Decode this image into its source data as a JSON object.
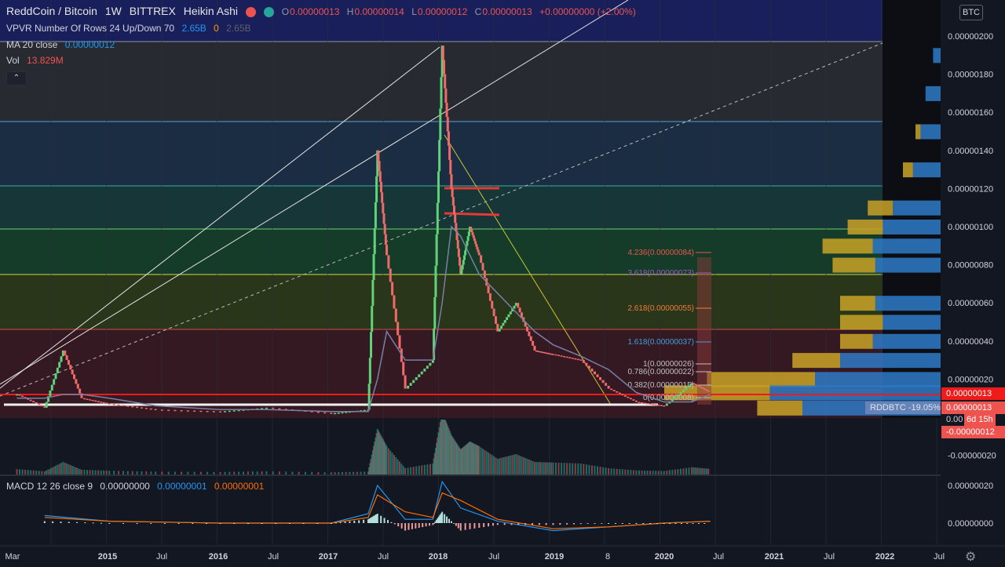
{
  "header": {
    "symbol": "ReddCoin / Bitcoin",
    "interval": "1W",
    "exchange": "BITTREX",
    "chart_style": "Heikin Ashi",
    "ohlc": [
      {
        "label": "O",
        "value": "0.00000013"
      },
      {
        "label": "H",
        "value": "0.00000014"
      },
      {
        "label": "L",
        "value": "0.00000012"
      },
      {
        "label": "C",
        "value": "0.00000013"
      }
    ],
    "change": "+0.00000000 (+2.00%)"
  },
  "indicators": {
    "vpvr": {
      "name": "VPVR Number Of Rows 24 Up/Down 70",
      "up": "2.65B",
      "down": "0",
      "total": "2.65B"
    },
    "ma": {
      "name": "MA 20 close",
      "value": "0.00000012"
    },
    "vol": {
      "name": "Vol",
      "value": "13.829M"
    },
    "macd": {
      "name": "MACD 12 26 close 9",
      "hist": "0.00000000",
      "macd": "0.00000001",
      "signal": "0.00000001"
    }
  },
  "currency_button": "BTC",
  "price_tags": {
    "last": "0.00000013",
    "ma": "0.00000013",
    "countdown_prefix": "0.00",
    "countdown": "6d 15h",
    "low": "-0.00000012",
    "symbol_change": "RDDBTC -19.05%"
  },
  "colors": {
    "background": "#131722",
    "up": "#26a69a",
    "down": "#ef5350",
    "ma": "#7a7fa8",
    "macd_line": "#2196f3",
    "signal_line": "#ff6d00",
    "vpvr_up": "#2f7ac7",
    "vpvr_down": "#c9a227"
  },
  "chart_data": [
    {
      "type": "line",
      "title": "ReddCoin / Bitcoin",
      "xlabel": "",
      "ylabel": "",
      "x_ticks": [
        "Mar",
        "2015",
        "Jul",
        "2016",
        "Jul",
        "2017",
        "Jul",
        "2018",
        "Jul",
        "2019",
        "8",
        "2020",
        "Jul",
        "2021",
        "Jul",
        "2022",
        "Jul"
      ],
      "y_ticks": [
        "0.00000200",
        "0.00000180",
        "0.00000160",
        "0.00000140",
        "0.00000120",
        "0.00000100",
        "0.00000080",
        "0.00000060",
        "0.00000040",
        "0.00000020",
        "-0.00000020"
      ],
      "ylim": [
        -3e-07,
        2.1e-06
      ],
      "x": [
        "2014-03",
        "2014-06",
        "2014-08",
        "2014-10",
        "2015-01",
        "2015-06",
        "2016-01",
        "2016-06",
        "2017-01",
        "2017-05",
        "2017-06",
        "2017-07",
        "2017-09",
        "2017-12",
        "2018-01",
        "2018-02",
        "2018-03",
        "2018-04",
        "2018-05",
        "2018-07",
        "2018-09",
        "2018-11",
        "2019-01",
        "2019-04",
        "2019-07",
        "2019-10",
        "2020-01",
        "2020-04",
        "2020-06"
      ],
      "series": [
        {
          "name": "close",
          "values": [
            1.2e-07,
            5e-08,
            3.5e-07,
            1e-07,
            7e-08,
            4e-08,
            3e-08,
            5e-08,
            2e-08,
            4e-08,
            1.4e-06,
            8.5e-07,
            1.5e-07,
            3e-07,
            1.95e-06,
            1.2e-06,
            7.5e-07,
            1e-06,
            8.5e-07,
            4.5e-07,
            6e-07,
            3.5e-07,
            3.3e-07,
            3e-07,
            1.5e-07,
            8e-08,
            6e-08,
            1.8e-07,
            1.3e-07
          ]
        },
        {
          "name": "MA 20 close",
          "values": [
            1e-07,
            1e-07,
            1.2e-07,
            1.2e-07,
            1e-07,
            6e-08,
            4e-08,
            4e-08,
            3e-08,
            3e-08,
            2e-07,
            4.5e-07,
            3e-07,
            3e-07,
            6e-07,
            1e-06,
            9.5e-07,
            8.5e-07,
            7.5e-07,
            6.5e-07,
            5.5e-07,
            4.5e-07,
            3.8e-07,
            3.2e-07,
            2.5e-07,
            1.3e-07,
            8e-08,
            8e-08,
            1.2e-07
          ]
        }
      ],
      "fib_levels": [
        {
          "label": "4.236(0.00000084)",
          "value": 8.4e-07
        },
        {
          "label": "3.618(0.00000073)",
          "value": 7.3e-07
        },
        {
          "label": "2.618(0.00000055)",
          "value": 5.5e-07
        },
        {
          "label": "1.618(0.00000037)",
          "value": 3.7e-07
        },
        {
          "label": "1(0.00000026)",
          "value": 2.6e-07
        },
        {
          "label": "0.786(0.00000022)",
          "value": 2.2e-07
        },
        {
          "label": "0.382(0.00000015)",
          "value": 1.5e-07
        },
        {
          "label": "0(0.00000008)",
          "value": 8e-08
        }
      ],
      "vpvr_rows": [
        {
          "price": 1.9e-06,
          "up": 0.03,
          "down": 0.0
        },
        {
          "price": 1.7e-06,
          "up": 0.06,
          "down": 0.0
        },
        {
          "price": 1.5e-06,
          "up": 0.08,
          "down": 0.02
        },
        {
          "price": 1.3e-06,
          "up": 0.11,
          "down": 0.04
        },
        {
          "price": 1.1e-06,
          "up": 0.19,
          "down": 0.1
        },
        {
          "price": 1e-06,
          "up": 0.23,
          "down": 0.14
        },
        {
          "price": 9e-07,
          "up": 0.27,
          "down": 0.2
        },
        {
          "price": 8e-07,
          "up": 0.26,
          "down": 0.17
        },
        {
          "price": 6e-07,
          "up": 0.26,
          "down": 0.14
        },
        {
          "price": 5e-07,
          "up": 0.23,
          "down": 0.17
        },
        {
          "price": 4e-07,
          "up": 0.27,
          "down": 0.13
        },
        {
          "price": 3e-07,
          "up": 0.4,
          "down": 0.19
        },
        {
          "price": 2e-07,
          "up": 0.5,
          "down": 0.43
        },
        {
          "price": 1.3e-07,
          "up": 0.68,
          "down": 0.42
        },
        {
          "price": 5e-08,
          "up": 0.55,
          "down": 0.18
        }
      ]
    },
    {
      "type": "line",
      "title": "MACD 12 26 close 9",
      "y_ticks": [
        "0.00000020",
        "0.00000000"
      ],
      "ylim": [
        -1e-07,
        2.5e-07
      ],
      "x": [
        "2014-06",
        "2015-01",
        "2016-01",
        "2017-01",
        "2017-05",
        "2017-06",
        "2017-09",
        "2017-12",
        "2018-01",
        "2018-03",
        "2018-07",
        "2019-01",
        "2019-07",
        "2020-01",
        "2020-06"
      ],
      "series": [
        {
          "name": "MACD",
          "values": [
            4e-08,
            1e-08,
            0.0,
            0.0,
            5e-08,
            2e-07,
            2e-08,
            2e-08,
            2.2e-07,
            8e-08,
            1e-08,
            -4e-08,
            -2e-08,
            0.0,
            1e-08
          ]
        },
        {
          "name": "Signal",
          "values": [
            3e-08,
            1e-08,
            0.0,
            0.0,
            3e-08,
            1.5e-07,
            6e-08,
            3e-08,
            1.6e-07,
            1.2e-07,
            2e-08,
            -3e-08,
            -2e-08,
            0.0,
            1e-08
          ]
        }
      ]
    }
  ]
}
